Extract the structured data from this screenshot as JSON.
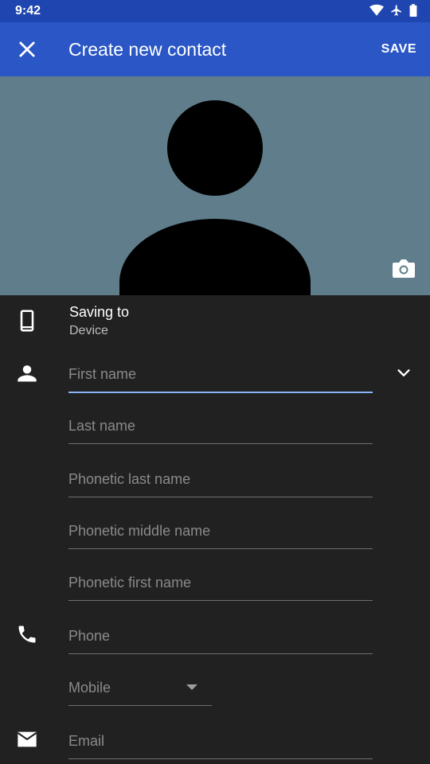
{
  "status_bar": {
    "time": "9:42",
    "icons": [
      "wifi-icon",
      "airplane-icon",
      "battery-icon"
    ]
  },
  "app_bar": {
    "title": "Create new contact",
    "save_label": "SAVE",
    "close_icon": "close-icon"
  },
  "photo": {
    "background_color": "#607d8b",
    "camera_icon": "camera-icon"
  },
  "account": {
    "label": "Saving to",
    "value": "Device",
    "icon": "phone-device-icon"
  },
  "name_fields": [
    {
      "placeholder": "First name",
      "value": ""
    },
    {
      "placeholder": "Last name",
      "value": ""
    },
    {
      "placeholder": "Phonetic last name",
      "value": ""
    },
    {
      "placeholder": "Phonetic middle name",
      "value": ""
    },
    {
      "placeholder": "Phonetic first name",
      "value": ""
    }
  ],
  "phone": {
    "placeholder": "Phone",
    "type_selected": "Mobile",
    "icon": "phone-icon"
  },
  "email": {
    "placeholder": "Email",
    "icon": "email-icon"
  },
  "colors": {
    "status_bar": "#1f46b0",
    "app_bar": "#2a56c6",
    "background": "#212121",
    "focus_underline": "#8ab4f8"
  }
}
